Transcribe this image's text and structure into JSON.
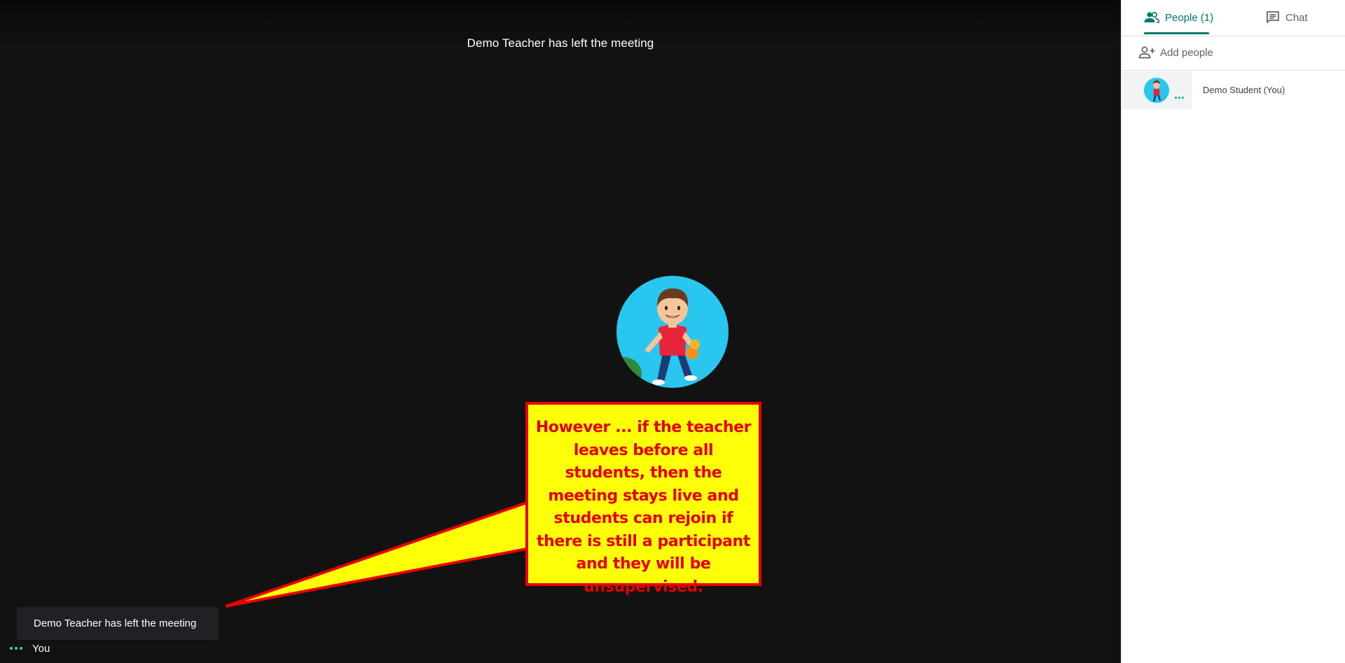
{
  "banner": {
    "text": "Demo Teacher has left the meeting"
  },
  "callout": {
    "text": "However ... if the teacher leaves before all students, then the meeting stays live and students can rejoin if there is still a participant and they will be unsupervised.",
    "fill_color": "#ffff0a",
    "text_color": "#e80000"
  },
  "toast": {
    "text": "Demo Teacher has left the meeting"
  },
  "self_tile": {
    "label": "You"
  },
  "panel": {
    "tabs": [
      {
        "label": "People (1)",
        "icon": "people-icon",
        "active": true
      },
      {
        "label": "Chat",
        "icon": "chat-icon",
        "active": false
      }
    ],
    "add_people_label": "Add people",
    "participants": [
      {
        "name": "Demo Student (You)",
        "icon": "avatar"
      }
    ]
  },
  "colors": {
    "accent": "#00796b",
    "stage_bg": "#121212",
    "avatar_bg": "#29c6ef"
  }
}
